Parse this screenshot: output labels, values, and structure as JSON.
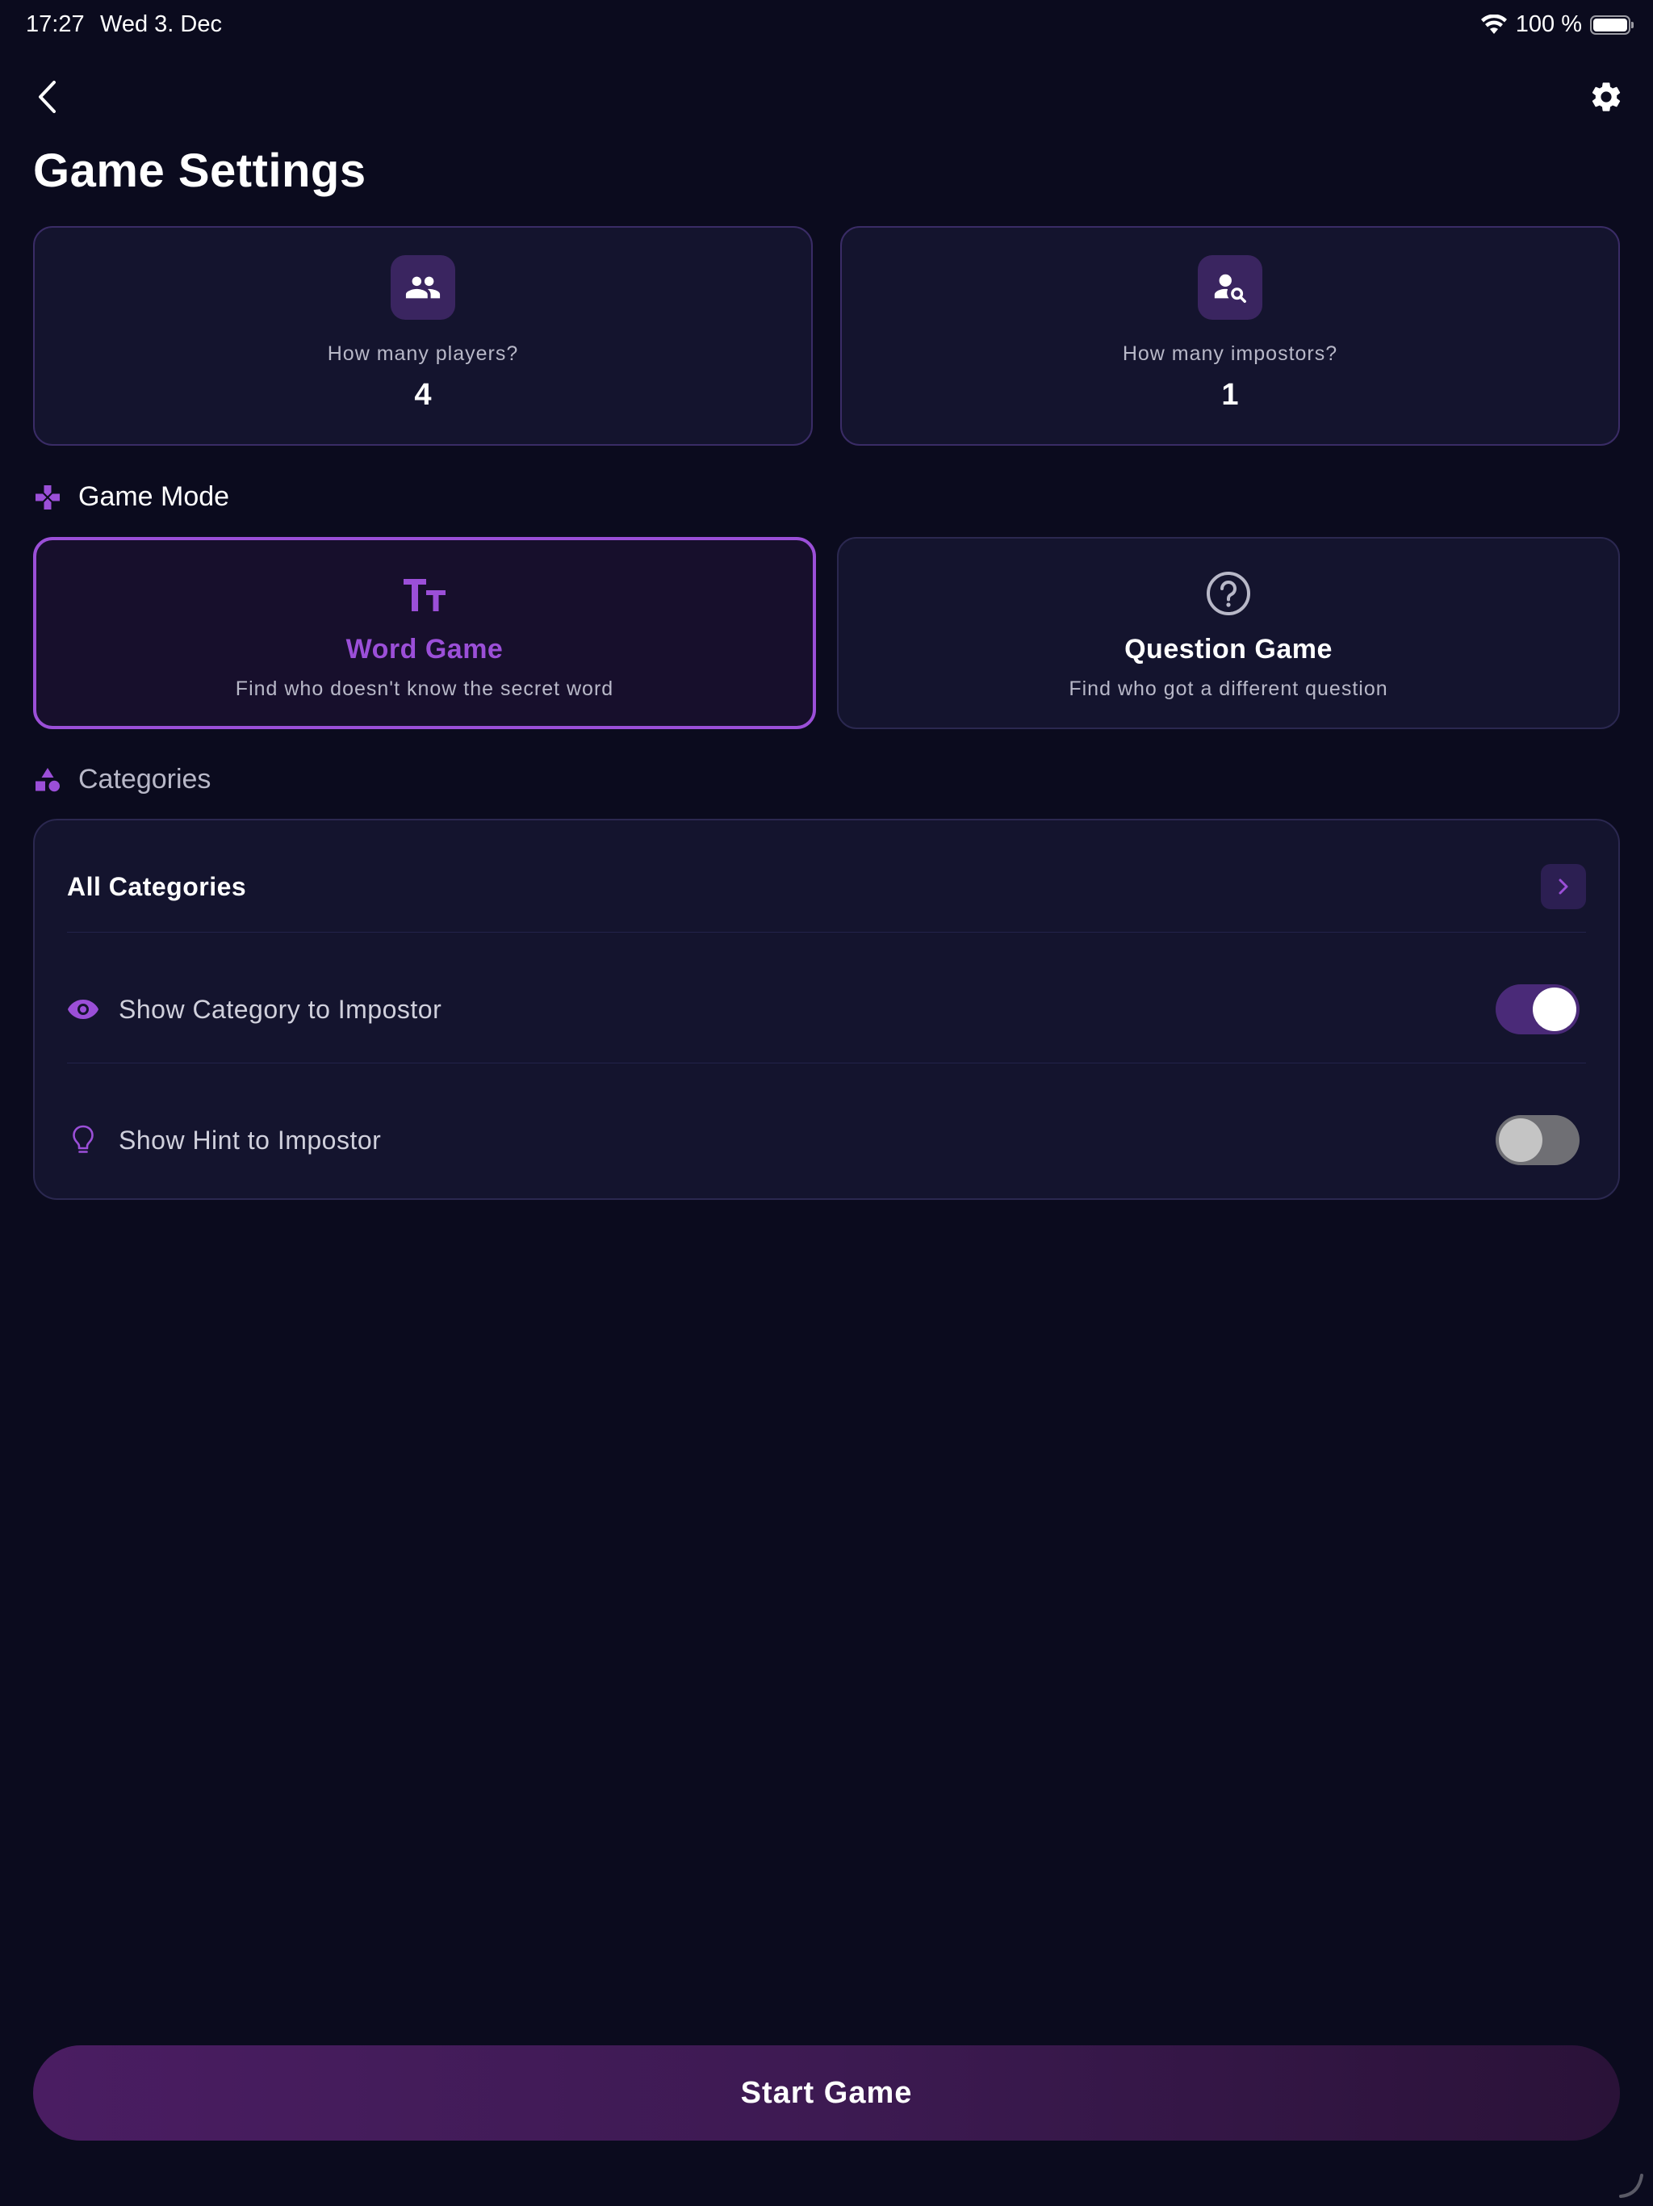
{
  "status_bar": {
    "time": "17:27",
    "date": "Wed 3. Dec",
    "battery_text": "100 %",
    "battery_level": 1.0
  },
  "header": {
    "title": "Game Settings",
    "back_icon": "chevron-left-icon",
    "settings_icon": "gear-icon"
  },
  "counters": {
    "players": {
      "label": "How many players?",
      "value": "4",
      "icon": "people-icon"
    },
    "impostors": {
      "label": "How many impostors?",
      "value": "1",
      "icon": "person-search-icon"
    }
  },
  "game_mode": {
    "heading": "Game Mode",
    "icon": "gamepad-icon",
    "selected": "word",
    "modes": [
      {
        "id": "word",
        "title": "Word Game",
        "description": "Find who doesn't know the secret word",
        "icon": "text-size-icon"
      },
      {
        "id": "question",
        "title": "Question Game",
        "description": "Find who got a different question",
        "icon": "question-circle-icon"
      }
    ]
  },
  "categories": {
    "heading": "Categories",
    "icon": "shapes-icon",
    "selection_label": "All Categories",
    "options": [
      {
        "label": "Show Category to Impostor",
        "icon": "eye-icon",
        "enabled": true
      },
      {
        "label": "Show Hint to Impostor",
        "icon": "lightbulb-icon",
        "enabled": false
      }
    ]
  },
  "actions": {
    "start_label": "Start Game"
  },
  "colors": {
    "background": "#0b0b1e",
    "card": "#14142e",
    "accent": "#9b4fd8",
    "icon_box": "#3a2560",
    "toggle_on": "#4a2a78",
    "toggle_off": "#6f6f74",
    "start_gradient_from": "#4a1d62",
    "start_gradient_to": "#2a1238"
  }
}
